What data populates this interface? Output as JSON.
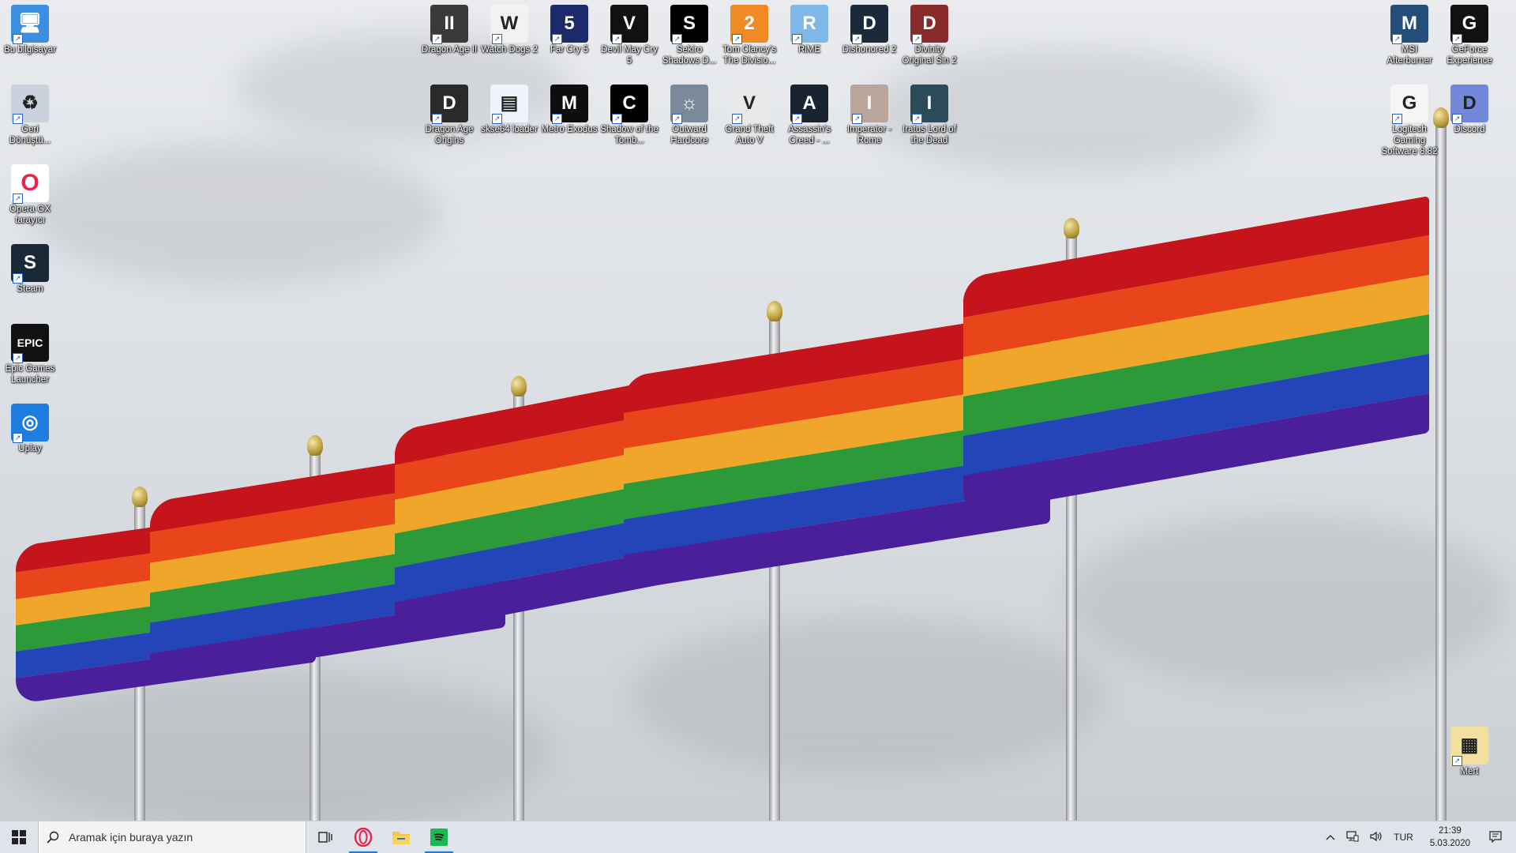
{
  "desktop": {
    "left_icons": [
      {
        "label": "Bu bilgisayar",
        "icon": "computer-icon"
      },
      {
        "label": "Geri Dönüştü...",
        "icon": "recycle-bin-icon"
      },
      {
        "label": "Opera GX tarayıcı",
        "icon": "opera-gx-icon"
      },
      {
        "label": "Steam",
        "icon": "steam-icon"
      },
      {
        "label": "Epic Games Launcher",
        "icon": "epic-games-icon"
      },
      {
        "label": "Uplay",
        "icon": "uplay-icon"
      }
    ],
    "top_row1": [
      {
        "label": "Dragon Age II",
        "icon": "dragon-age-2-icon"
      },
      {
        "label": "Watch Dogs 2",
        "icon": "watch-dogs-2-icon"
      },
      {
        "label": "Far Cry 5",
        "icon": "far-cry-5-icon"
      },
      {
        "label": "Devil May Cry 5",
        "icon": "devil-may-cry-5-icon"
      },
      {
        "label": "Sekiro Shadows D...",
        "icon": "sekiro-icon"
      },
      {
        "label": "Tom Clancy's The Divisio...",
        "icon": "the-division-2-icon"
      },
      {
        "label": "RiME",
        "icon": "rime-icon"
      },
      {
        "label": "Dishonored 2",
        "icon": "dishonored-2-icon"
      },
      {
        "label": "Divinity Original Sin 2",
        "icon": "divinity-os2-icon"
      }
    ],
    "top_row2": [
      {
        "label": "Dragon Age Origins",
        "icon": "dragon-age-origins-icon"
      },
      {
        "label": "skse64 loader",
        "icon": "skse64-loader-icon"
      },
      {
        "label": "Metro Exodus",
        "icon": "metro-exodus-icon"
      },
      {
        "label": "Shadow of the Tomb...",
        "icon": "shadow-tomb-raider-icon"
      },
      {
        "label": "Outward Hardcore",
        "icon": "outward-icon"
      },
      {
        "label": "Grand Theft Auto V",
        "icon": "gta-v-icon"
      },
      {
        "label": "Assassin's Creed - ...",
        "icon": "assassins-creed-icon"
      },
      {
        "label": "Imperator - Rome",
        "icon": "imperator-rome-icon"
      },
      {
        "label": "Iratus Lord of the Dead",
        "icon": "iratus-icon"
      }
    ],
    "right_icons": [
      {
        "label": "MSI Afterburner",
        "icon": "msi-afterburner-icon"
      },
      {
        "label": "GeForce Experience",
        "icon": "geforce-experience-icon"
      },
      {
        "label": "Logitech Gaming Software 8.82",
        "icon": "logitech-icon"
      },
      {
        "label": "Discord",
        "icon": "discord-icon"
      },
      {
        "label": "Mert",
        "icon": "winrar-archive-icon"
      }
    ]
  },
  "taskbar": {
    "search_placeholder": "Aramak için buraya yazın",
    "language": "TUR",
    "time": "21:39",
    "date": "5.03.2020"
  }
}
